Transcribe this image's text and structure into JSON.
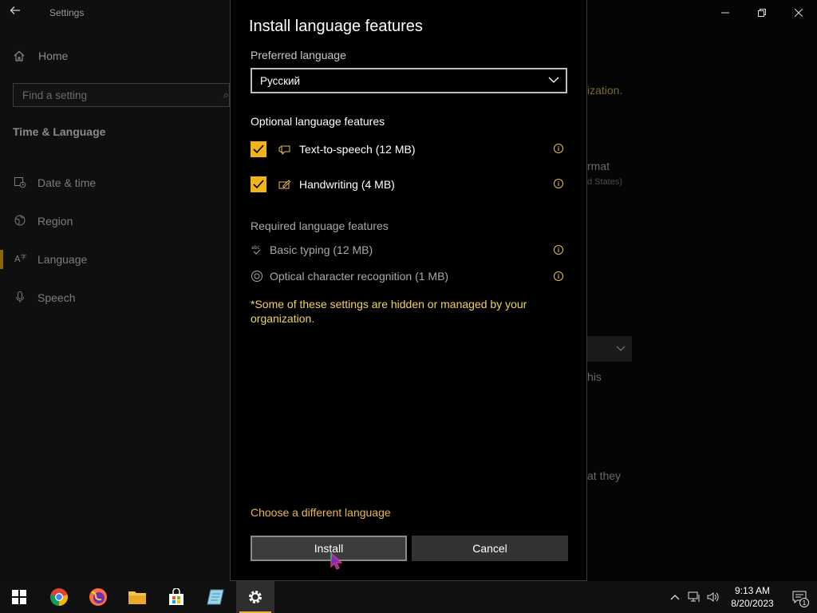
{
  "settings": {
    "app_title": "Settings",
    "home_label": "Home",
    "search_placeholder": "Find a setting",
    "section_title": "Time & Language",
    "nav_items": [
      {
        "label": "Date & time",
        "icon": "calendar-clock-icon"
      },
      {
        "label": "Region",
        "icon": "globe-icon"
      },
      {
        "label": "Language",
        "icon": "language-icon",
        "active": true
      },
      {
        "label": "Speech",
        "icon": "microphone-icon"
      }
    ],
    "bg_fragments": {
      "organization": "ization.",
      "format": "rmat",
      "united_states": "d States)",
      "this": "his",
      "that_they": "at they"
    }
  },
  "dialog": {
    "title": "Install language features",
    "preferred_label": "Preferred language",
    "selected_language": "Русский",
    "optional_label": "Optional language features",
    "optional_features": [
      {
        "label": "Text-to-speech (12 MB)",
        "checked": true,
        "icon": "text-to-speech-icon"
      },
      {
        "label": "Handwriting (4 MB)",
        "checked": true,
        "icon": "handwriting-icon"
      }
    ],
    "required_label": "Required language features",
    "required_features": [
      {
        "label": "Basic typing (12 MB)",
        "icon": "basic-typing-icon",
        "icon_text": "abc"
      },
      {
        "label": "Optical character recognition (1 MB)",
        "icon": "ocr-icon"
      }
    ],
    "managed_note": "*Some of these settings are hidden or managed by your organization.",
    "choose_link": "Choose a different language",
    "install_label": "Install",
    "cancel_label": "Cancel"
  },
  "taskbar": {
    "apps": [
      "start",
      "chrome",
      "firefox",
      "file-explorer",
      "store",
      "notepad",
      "settings"
    ],
    "active_app": "settings",
    "time": "9:13 AM",
    "date": "8/20/2023",
    "notification_count": "1"
  },
  "colors": {
    "accent": "#f0b41a",
    "note": "#f0d35a",
    "link": "#e9b84a"
  }
}
